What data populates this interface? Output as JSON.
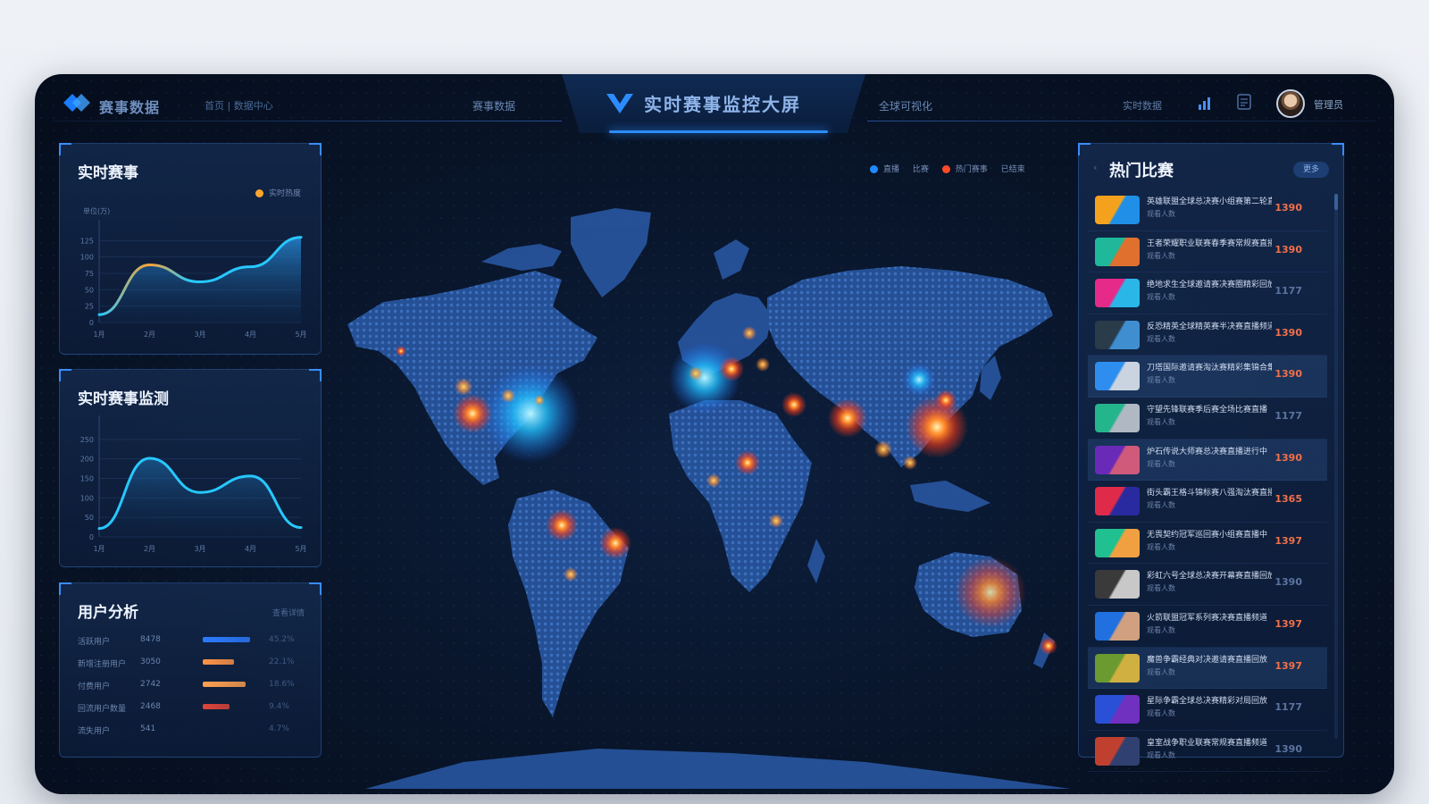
{
  "header": {
    "brand": "赛事数据",
    "subnav": "首页 | 数据中心",
    "nav_left": "赛事数据",
    "title": "实时赛事监控大屏",
    "nav_right": "全球可视化",
    "status": "实时数据",
    "user_name": "管理员"
  },
  "colors": {
    "accent": "#2b8cff",
    "heat_hot": "#ff5a2a",
    "heat_warm": "#ffb347",
    "heat_cool": "#1fb6ff",
    "series_line": "#27c8ff"
  },
  "panel1": {
    "title": "实时赛事",
    "legend": "实时热度",
    "ylabel": "单位(万)",
    "chart_data": {
      "type": "area",
      "categories": [
        "1月",
        "2月",
        "3月",
        "4月",
        "5月"
      ],
      "values": [
        12,
        88,
        62,
        85,
        130
      ],
      "yticks": [
        "0",
        "25",
        "50",
        "75",
        "100",
        "125"
      ],
      "ylim": [
        0,
        150
      ]
    }
  },
  "panel2": {
    "title": "实时赛事监测",
    "chart_data": {
      "type": "line",
      "categories": [
        "1月",
        "2月",
        "3月",
        "4月",
        "5月"
      ],
      "values": [
        18,
        168,
        95,
        130,
        20
      ],
      "yticks": [
        "0",
        "50",
        "100",
        "150",
        "200",
        "250"
      ],
      "ylim": [
        0,
        250
      ]
    }
  },
  "panel3": {
    "title": "用户分析",
    "right_label": "查看详情",
    "rows": [
      {
        "c1": "活跃用户",
        "c2": "8478",
        "pct": 0.98,
        "color": "#2b7bff",
        "c4": "45.2%"
      },
      {
        "c1": "新增注册用户",
        "c2": "3050",
        "pct": 0.65,
        "color": "#ff9448",
        "c4": "22.1%"
      },
      {
        "c1": "付费用户",
        "c2": "2742",
        "pct": 0.88,
        "color": "#ffa050",
        "c4": "18.6%"
      },
      {
        "c1": "回流用户数量",
        "c2": "2468",
        "pct": 0.55,
        "color": "#e0453a",
        "c4": "9.4%"
      },
      {
        "c1": "流失用户",
        "c2": "541",
        "pct": 0.0,
        "color": "#3a5f99",
        "c4": "4.7%"
      }
    ]
  },
  "map": {
    "legend": [
      "直播",
      "比赛",
      "热门赛事",
      "已结束"
    ]
  },
  "hot": {
    "title": "热门比赛",
    "badge": "更多",
    "items": [
      {
        "name": "英雄联盟全球总决赛小组赛第二轮直播",
        "sub": "观看人数",
        "num": "1390",
        "thumb": [
          "#f4a21e",
          "#1f8fe8"
        ],
        "hot": true,
        "hl": false
      },
      {
        "name": "王者荣耀职业联赛春季赛常规赛直播",
        "sub": "观看人数",
        "num": "1390",
        "thumb": [
          "#1fb89a",
          "#e0702d"
        ],
        "hot": true,
        "hl": false
      },
      {
        "name": "绝地求生全球邀请赛决赛圈精彩回放",
        "sub": "观看人数",
        "num": "1177",
        "thumb": [
          "#e62a8a",
          "#2bb6e8"
        ],
        "hot": false,
        "hl": false
      },
      {
        "name": "反恐精英全球精英赛半决赛直播频道",
        "sub": "观看人数",
        "num": "1390",
        "thumb": [
          "#2a3b4a",
          "#3f8fd0"
        ],
        "hot": true,
        "hl": false
      },
      {
        "name": "刀塔国际邀请赛淘汰赛精彩集锦合集",
        "sub": "观看人数",
        "num": "1390",
        "thumb": [
          "#2e8ef0",
          "#c9d4e0"
        ],
        "hot": true,
        "hl": true
      },
      {
        "name": "守望先锋联赛季后赛全场比赛直播",
        "sub": "观看人数",
        "num": "1177",
        "thumb": [
          "#25b58c",
          "#b0b8c4"
        ],
        "hot": false,
        "hl": false
      },
      {
        "name": "炉石传说大师赛总决赛直播进行中",
        "sub": "观看人数",
        "num": "1390",
        "thumb": [
          "#6a2ab8",
          "#d05a7a"
        ],
        "hot": true,
        "hl": true
      },
      {
        "name": "街头霸王格斗锦标赛八强淘汰赛直播",
        "sub": "观看人数",
        "num": "1365",
        "thumb": [
          "#e02a4a",
          "#2a2aa0"
        ],
        "hot": true,
        "hl": false
      },
      {
        "name": "无畏契约冠军巡回赛小组赛直播中",
        "sub": "观看人数",
        "num": "1397",
        "thumb": [
          "#20c090",
          "#f0a040"
        ],
        "hot": true,
        "hl": false
      },
      {
        "name": "彩虹六号全球总决赛开幕赛直播回放",
        "sub": "观看人数",
        "num": "1390",
        "thumb": [
          "#3a3a3a",
          "#c8c8c8"
        ],
        "hot": false,
        "hl": false
      },
      {
        "name": "火箭联盟冠军系列赛决赛直播频道",
        "sub": "观看人数",
        "num": "1397",
        "thumb": [
          "#2070e0",
          "#d0a080"
        ],
        "hot": true,
        "hl": false
      },
      {
        "name": "魔兽争霸经典对决邀请赛直播回放",
        "sub": "观看人数",
        "num": "1397",
        "thumb": [
          "#6a9a30",
          "#d0b040"
        ],
        "hot": true,
        "hl": true
      },
      {
        "name": "星际争霸全球总决赛精彩对局回放",
        "sub": "观看人数",
        "num": "1177",
        "thumb": [
          "#2a50d8",
          "#7030c0"
        ],
        "hot": false,
        "hl": false
      },
      {
        "name": "皇室战争职业联赛常规赛直播频道",
        "sub": "观看人数",
        "num": "1390",
        "thumb": [
          "#c04030",
          "#304070"
        ],
        "hot": false,
        "hl": false
      }
    ]
  }
}
